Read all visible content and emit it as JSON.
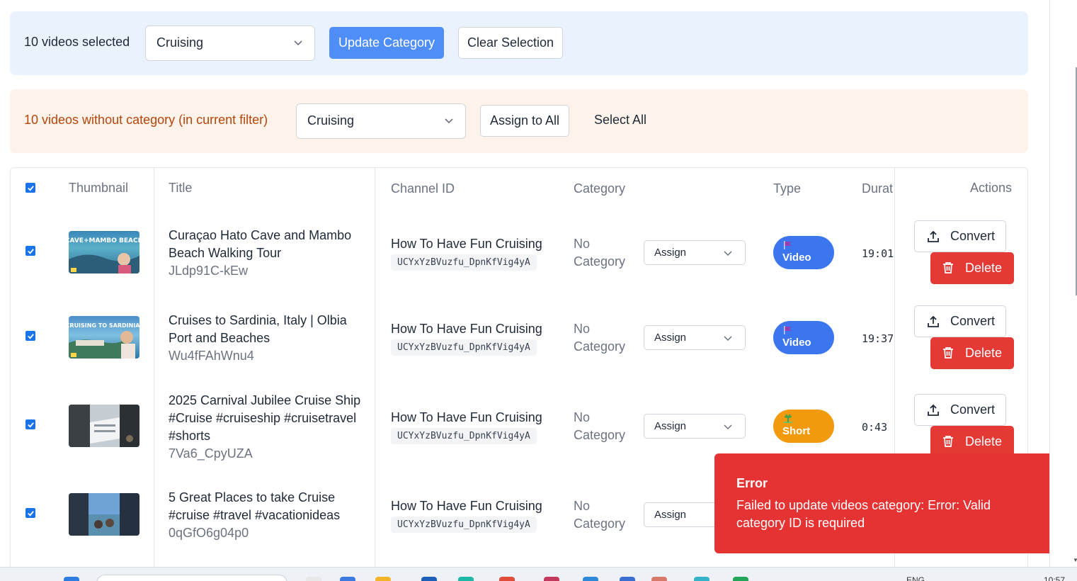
{
  "bulk_bar": {
    "selected_count_text": "10 videos selected",
    "category_select_value": "Cruising",
    "update_button": "Update Category",
    "clear_button": "Clear Selection"
  },
  "uncategorized_bar": {
    "text": "10 videos without category (in current filter)",
    "category_select_value": "Cruising",
    "assign_all_button": "Assign to All",
    "select_all_button": "Select All"
  },
  "table": {
    "headers": {
      "thumbnail": "Thumbnail",
      "title": "Title",
      "channel_id": "Channel ID",
      "category": "Category",
      "type": "Type",
      "duration": "Durat",
      "actions": "Actions"
    },
    "rows": [
      {
        "selected": true,
        "title": "Curaçao Hato Cave and Mambo Beach Walking Tour",
        "video_id": "JLdp91C-kEw",
        "thumb_caption": "CAVE+MAMBO BEACH",
        "channel_name": "How To Have Fun Cruising",
        "channel_id": "UCYxYzBVuzfu_DpnKfVig4yA",
        "category": "No Category",
        "assign_label": "Assign",
        "type": "Video",
        "type_icon": "flag-icon",
        "duration": "19:01",
        "convert_label": "Convert",
        "delete_label": "Delete"
      },
      {
        "selected": true,
        "title": "Cruises to Sardinia, Italy | Olbia Port and Beaches",
        "video_id": "Wu4fFAhWnu4",
        "thumb_caption": "CRUISING TO SARDINIA",
        "channel_name": "How To Have Fun Cruising",
        "channel_id": "UCYxYzBVuzfu_DpnKfVig4yA",
        "category": "No Category",
        "assign_label": "Assign",
        "type": "Video",
        "type_icon": "flag-icon",
        "duration": "19:37",
        "convert_label": "Convert",
        "delete_label": "Delete"
      },
      {
        "selected": true,
        "title": "2025 Carnival Jubilee Cruise Ship #Cruise #cruiseship #cruisetravel #shorts",
        "video_id": "7Va6_CpyUZA",
        "thumb_caption": "",
        "channel_name": "How To Have Fun Cruising",
        "channel_id": "UCYxYzBVuzfu_DpnKfVig4yA",
        "category": "No Category",
        "assign_label": "Assign",
        "type": "Short",
        "type_icon": "palm-icon",
        "duration": "0:43",
        "convert_label": "Convert",
        "delete_label": "Delete"
      },
      {
        "selected": true,
        "title": "5 Great Places to take Cruise #cruise #travel #vacationideas",
        "video_id": "0qGfO6g04p0",
        "thumb_caption": "",
        "channel_name": "How To Have Fun Cruising",
        "channel_id": "UCYxYzBVuzfu_DpnKfVig4yA",
        "category": "No Category",
        "assign_label": "Assign"
      }
    ]
  },
  "toast": {
    "title": "Error",
    "message": "Failed to update videos category: Error: Valid category ID is required"
  },
  "taskbar": {
    "language": "ENG",
    "time": "10:57"
  },
  "colors": {
    "primary": "#4f8ef7",
    "danger": "#e53935",
    "video_badge": "#3b76ee",
    "short_badge": "#f29a0e",
    "uncategorized_text": "#b7450b"
  }
}
